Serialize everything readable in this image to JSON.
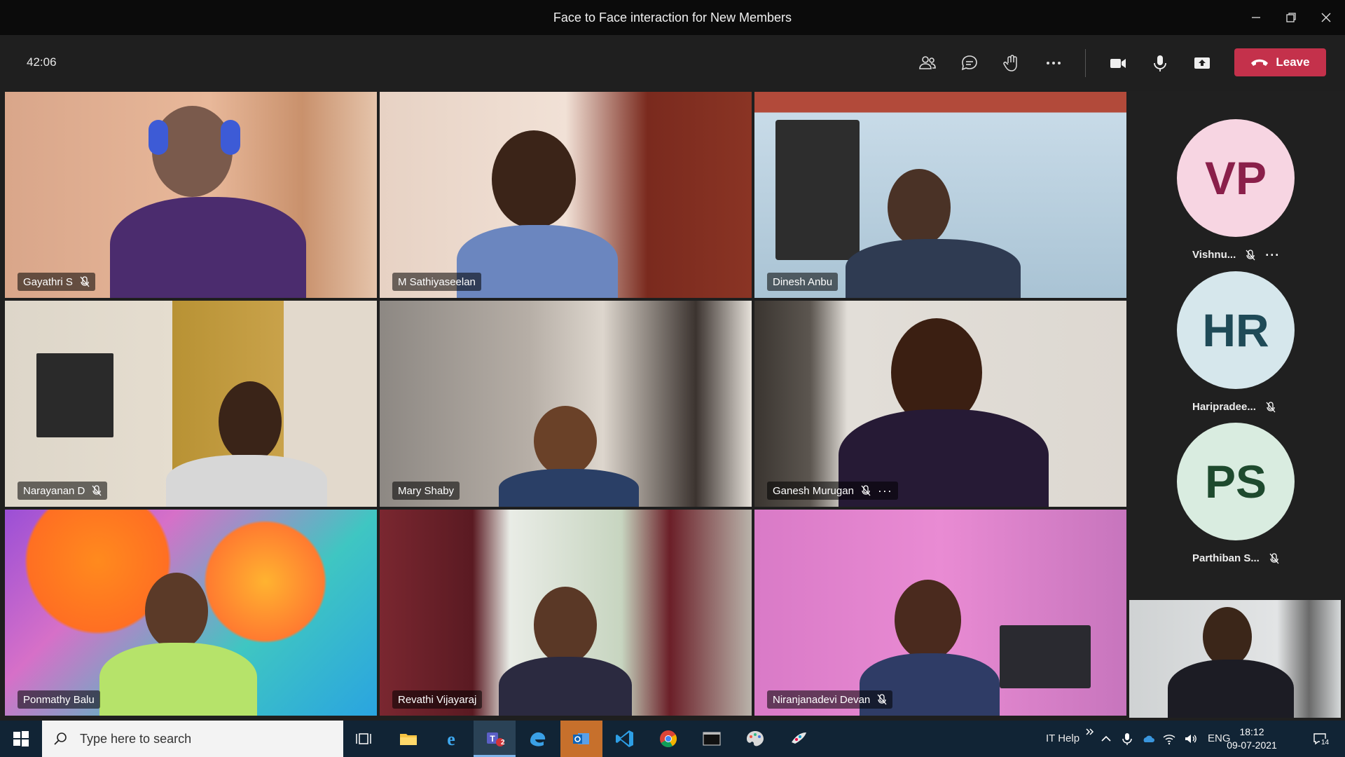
{
  "window": {
    "title": "Face to Face interaction for New Members"
  },
  "toolbar": {
    "timer": "42:06",
    "leave_label": "Leave"
  },
  "participants": [
    {
      "name": "Gayathri S",
      "muted": true
    },
    {
      "name": "M Sathiyaseelan",
      "muted": false
    },
    {
      "name": "Dinesh Anbu",
      "muted": false
    },
    {
      "name": "Narayanan D",
      "muted": true
    },
    {
      "name": "Mary Shaby",
      "muted": false
    },
    {
      "name": "Ganesh Murugan",
      "muted": true
    },
    {
      "name": "Ponmathy Balu",
      "muted": false
    },
    {
      "name": "Revathi Vijayaraj",
      "muted": false
    },
    {
      "name": "Niranjanadevi Devan",
      "muted": true
    }
  ],
  "side_participants": [
    {
      "initials": "VP",
      "name": "Vishnu...",
      "avatar_bg": "#f7d5e2",
      "avatar_fg": "#8a1f4a"
    },
    {
      "initials": "HR",
      "name": "Haripradee...",
      "avatar_bg": "#d6e7ec",
      "avatar_fg": "#1f4a57"
    },
    {
      "initials": "PS",
      "name": "Parthiban S...",
      "avatar_bg": "#d9ece0",
      "avatar_fg": "#1e4a2e"
    }
  ],
  "taskbar": {
    "search_placeholder": "Type here to search",
    "teams_badge": "2",
    "tray_label": "IT Help",
    "language": "ENG",
    "time": "18:12",
    "date": "09-07-2021",
    "notifications": "14"
  },
  "colors": {
    "leave": "#c4314b",
    "active_speaker": "#8b8cc7",
    "taskbar": "#112435"
  }
}
